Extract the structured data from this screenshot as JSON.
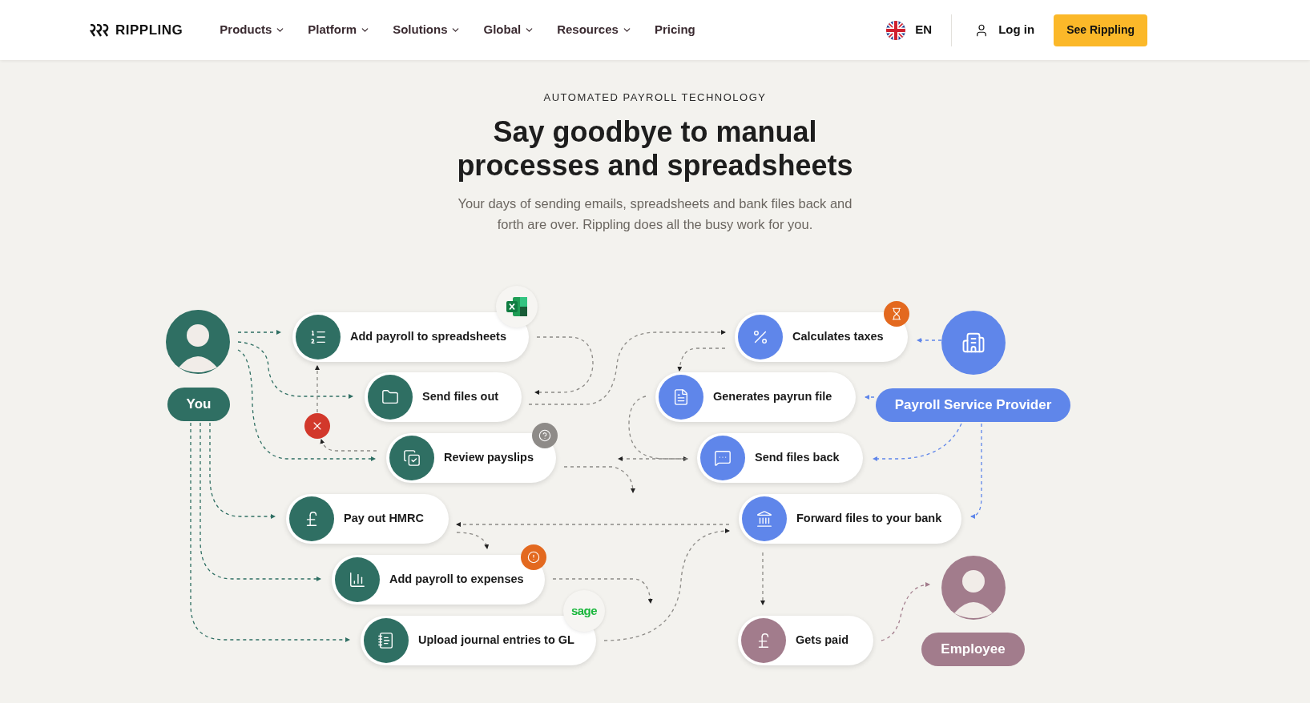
{
  "header": {
    "logo": "RIPPLING",
    "nav": [
      {
        "label": "Products",
        "dropdown": true
      },
      {
        "label": "Platform",
        "dropdown": true
      },
      {
        "label": "Solutions",
        "dropdown": true
      },
      {
        "label": "Global",
        "dropdown": true
      },
      {
        "label": "Resources",
        "dropdown": true
      },
      {
        "label": "Pricing",
        "dropdown": false
      }
    ],
    "language": "EN",
    "login": "Log in",
    "cta": "See Rippling"
  },
  "hero": {
    "eyebrow": "AUTOMATED PAYROLL TECHNOLOGY",
    "title_lines": [
      "Say goodbye to manual",
      "processes and spreadsheets"
    ],
    "subtitle_lines": [
      "Your days of sending emails, spreadsheets and bank files back and",
      "forth are over. Rippling does all the busy work for you."
    ]
  },
  "diagram": {
    "actors": [
      {
        "label": "You",
        "kind": "you"
      },
      {
        "label": "Payroll Service Provider",
        "kind": "provider"
      },
      {
        "label": "Employee",
        "kind": "employee"
      }
    ],
    "steps": [
      {
        "label": "Add payroll to spreadsheets",
        "kind": "you"
      },
      {
        "label": "Send files out",
        "kind": "you"
      },
      {
        "label": "Review payslips",
        "kind": "you"
      },
      {
        "label": "Pay out HMRC",
        "kind": "you"
      },
      {
        "label": "Add payroll to expenses",
        "kind": "you"
      },
      {
        "label": "Upload journal entries to GL",
        "kind": "you"
      },
      {
        "label": "Calculates taxes",
        "kind": "provider"
      },
      {
        "label": "Generates payrun file",
        "kind": "provider"
      },
      {
        "label": "Send files back",
        "kind": "provider"
      },
      {
        "label": "Forward files to your bank",
        "kind": "provider"
      },
      {
        "label": "Gets paid",
        "kind": "employee"
      }
    ],
    "badges": [
      {
        "kind": "excel"
      },
      {
        "kind": "error"
      },
      {
        "kind": "question"
      },
      {
        "kind": "warning"
      },
      {
        "kind": "sage",
        "label": "sage"
      },
      {
        "kind": "hourglass"
      }
    ]
  }
}
